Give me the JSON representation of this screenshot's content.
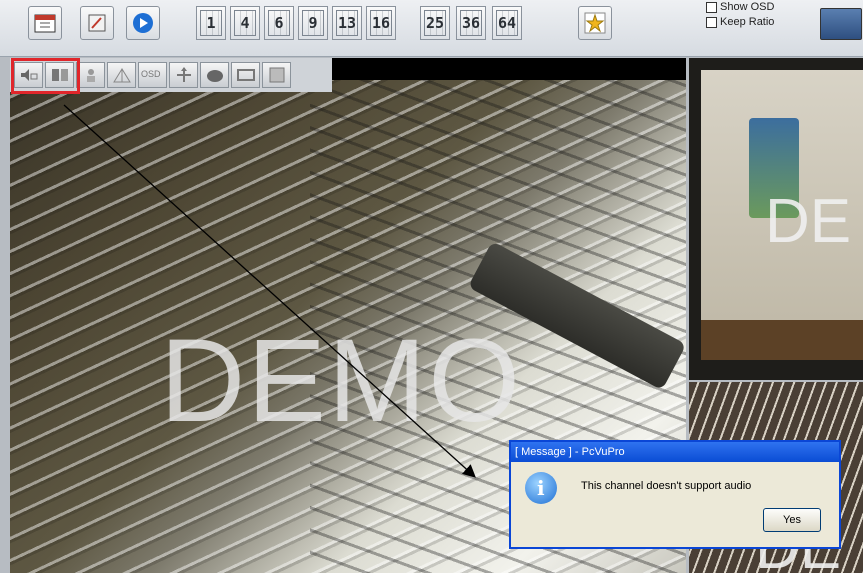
{
  "toolbar": {
    "left_buttons": [
      {
        "icon": "calendar-icon"
      },
      {
        "icon": "tools-icon"
      },
      {
        "icon": "play-icon"
      }
    ],
    "split_buttons": [
      "1",
      "4",
      "6",
      "9",
      "13",
      "16",
      "25",
      "36",
      "64"
    ],
    "extra_icon": "star-icon",
    "options": [
      {
        "label": "Show OSD"
      },
      {
        "label": "Keep Ratio"
      }
    ]
  },
  "channel_toolbar": {
    "buttons": [
      {
        "icon": "audio-icon"
      },
      {
        "icon": "ptz-icon"
      },
      {
        "icon": "record-icon"
      },
      {
        "icon": "snapshot-icon"
      },
      {
        "icon": "osd-icon"
      },
      {
        "icon": "zoom-icon"
      },
      {
        "icon": "talk-icon"
      },
      {
        "icon": "display-icon"
      },
      {
        "icon": "settings-icon"
      }
    ],
    "osd_label": "OSD"
  },
  "video": {
    "main_watermark": "DEMO",
    "right_top_watermark": "DE",
    "right_bottom_watermark": "DE"
  },
  "dialog": {
    "title": "[ Message ] - PcVuPro",
    "message": "This channel doesn't support audio",
    "yes_label": "Yes"
  },
  "colors": {
    "highlight": "#e0262b",
    "dialog_title": "#0a4cd4"
  }
}
